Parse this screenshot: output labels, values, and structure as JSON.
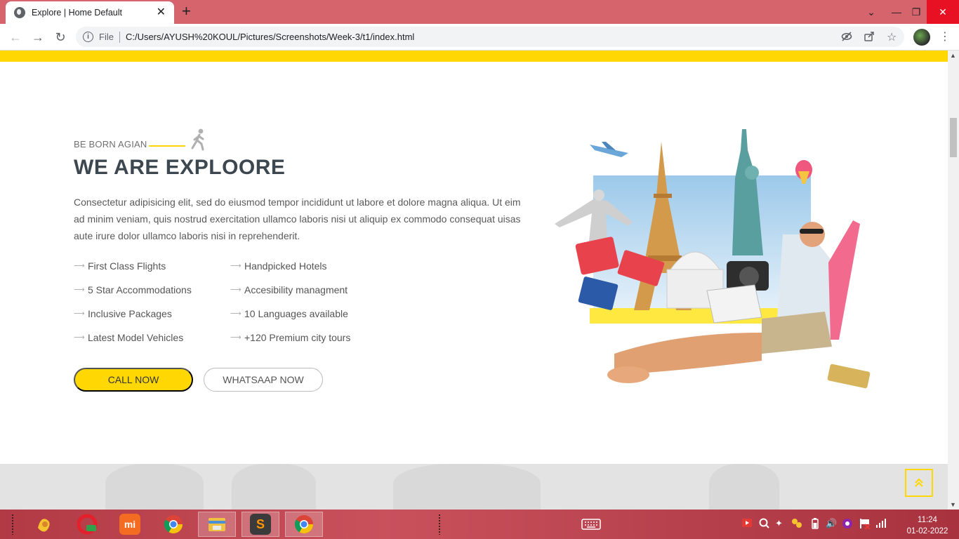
{
  "browser": {
    "tab_title": "Explore | Home Default",
    "tab_close": "✕",
    "new_tab": "+",
    "scheme": "File",
    "url": "C:/Users/AYUSH%20KOUL/Pictures/Screenshots/Week-3/t1/index.html"
  },
  "page": {
    "eyebrow": "BE BORN AGIAN",
    "heading": "WE ARE EXPLOORE",
    "intro": "Consectetur adipisicing elit, sed do eiusmod tempor incididunt ut labore et dolore magna aliqua. Ut eim ad minim veniam, quis nostrud exercitation ullamco laboris nisi ut aliquip ex commodo consequat uisas aute irure dolor ullamco laboris nisi in reprehenderit.",
    "features": [
      "First Class Flights",
      "Handpicked Hotels",
      "5 Star Accommodations",
      "Accesibility managment",
      "Inclusive Packages",
      "10 Languages available",
      "Latest Model Vehicles",
      "+120 Premium city tours"
    ],
    "call_button": "CALL NOW",
    "whatsapp_button": "WHATSAAP NOW",
    "accent_color": "#ffd803",
    "heading_color": "#3d4750"
  },
  "taskbar": {
    "time": "11:24",
    "date": "01-02-2022",
    "apps": [
      "honeygain-icon",
      "opera-gx-icon",
      "mi-icon",
      "chrome-icon",
      "file-explorer-icon",
      "sublime-text-icon",
      "chrome-icon"
    ],
    "mi_label": "mi",
    "sublime_label": "S"
  }
}
